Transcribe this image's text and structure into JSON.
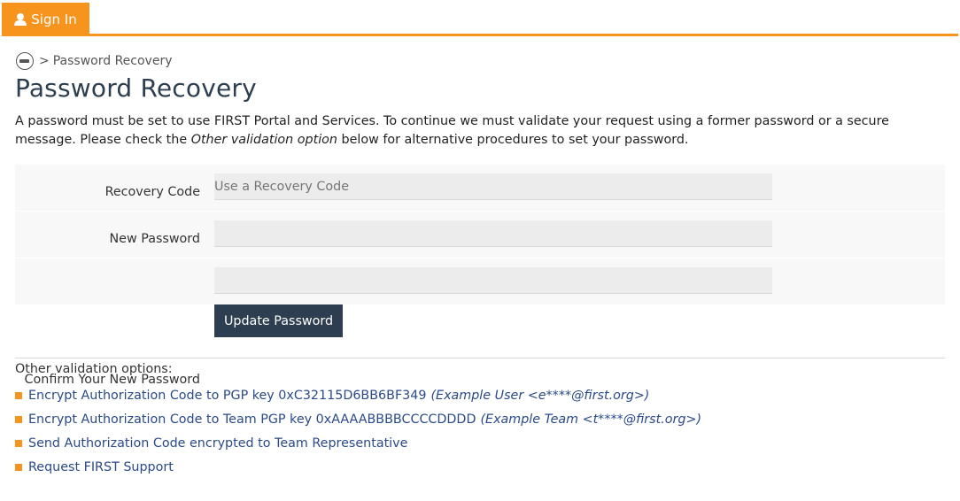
{
  "nav": {
    "signin_label": "Sign In"
  },
  "breadcrumb": {
    "separator": ">",
    "current": "Password Recovery"
  },
  "page": {
    "title": "Password Recovery",
    "intro_part1": "A password must be set to use FIRST Portal and Services. To continue we must validate your request using a former password or a secure message. Please check the ",
    "intro_emphasis": "Other validation option",
    "intro_part2": " below for alternative procedures to set your password."
  },
  "form": {
    "recovery_code": {
      "label": "Recovery Code",
      "placeholder": "Use a Recovery Code",
      "value": ""
    },
    "new_password": {
      "label": "New Password",
      "value": ""
    },
    "confirm_password": {
      "label": "Confirm Your New Password",
      "value": ""
    },
    "submit_label": "Update Password"
  },
  "other_options": {
    "title": "Other validation options:",
    "items": [
      {
        "label": "Encrypt Authorization Code to PGP key 0xC32115D6BB6BF349",
        "detail": "(Example User <e****@first.org>)"
      },
      {
        "label": "Encrypt Authorization Code to Team PGP key 0xAAAABBBBCCCCDDDD",
        "detail": "(Example Team <t****@first.org>)"
      },
      {
        "label": "Send Authorization Code encrypted to Team Representative",
        "detail": ""
      },
      {
        "label": "Request FIRST Support",
        "detail": ""
      }
    ]
  },
  "colors": {
    "accent": "#f7941d",
    "primary": "#2d3e50",
    "link": "#2a4a8a"
  }
}
